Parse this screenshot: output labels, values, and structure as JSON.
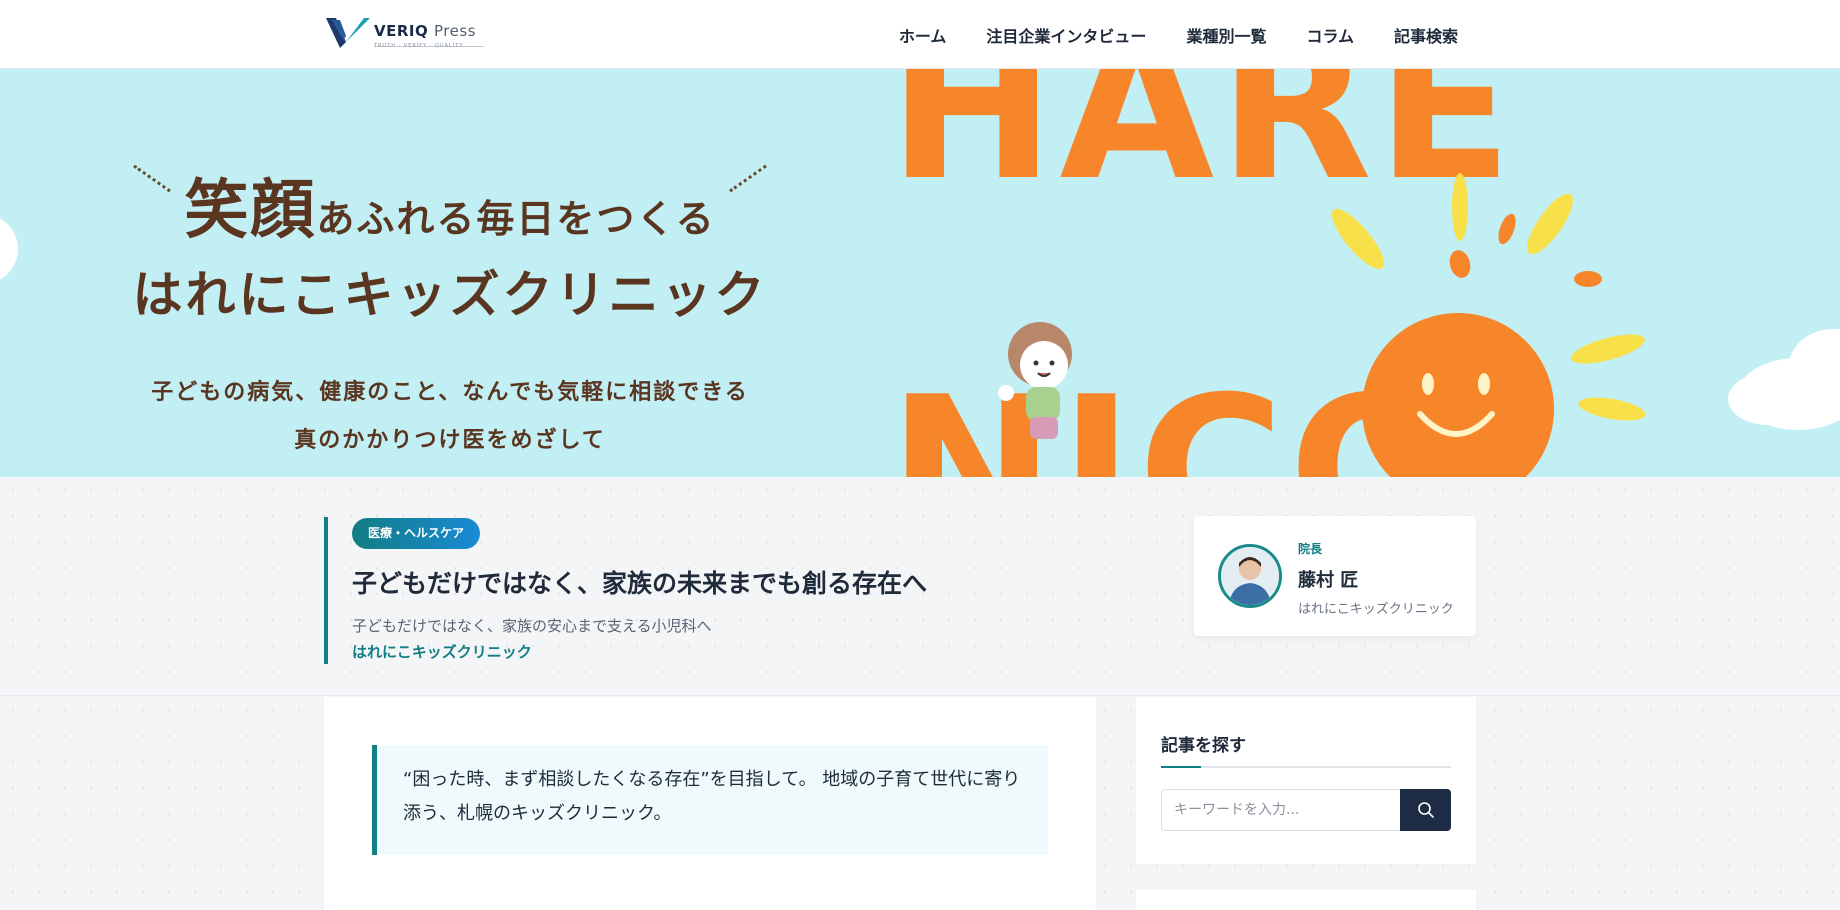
{
  "header": {
    "logo_name": "VERIQ",
    "logo_suffix": "Press",
    "logo_tagline": "TRUTH · VERIFY · QUALITY",
    "nav": [
      {
        "label": "ホーム"
      },
      {
        "label": "注目企業インタビュー"
      },
      {
        "label": "業種別一覧"
      },
      {
        "label": "コラム"
      },
      {
        "label": "記事検索"
      }
    ]
  },
  "hero": {
    "line1_big": "笑顔",
    "line1_rest": "あふれる毎日をつくる",
    "line2": "はれにこキッズクリニック",
    "line3a": "子どもの病気、健康のこと、なんでも気軽に相談できる",
    "line3b": "真のかかりつけ医をめざして",
    "art_text_top": "HARE",
    "art_text_bottom": "NICO"
  },
  "article": {
    "category": "医療・ヘルスケア",
    "title": "子どもだけではなく、家族の未来までも創る存在へ",
    "subtitle": "子どもだけではなく、家族の安心まで支える小児科へ",
    "company": "はれにこキッズクリニック",
    "lead": "“困った時、まず相談したくなる存在”を目指して。 地域の子育て世代に寄り添う、札幌のキッズクリニック。"
  },
  "author": {
    "role": "院長",
    "name": "藤村 匠",
    "org": "はれにこキッズクリニック"
  },
  "sidebar": {
    "search_title": "記事を探す",
    "search_placeholder": "キーワードを入力..."
  },
  "colors": {
    "accent": "#117d84",
    "hero_bg": "#c2eff3",
    "hero_orange": "#f7862b",
    "navy": "#1d2b44"
  }
}
